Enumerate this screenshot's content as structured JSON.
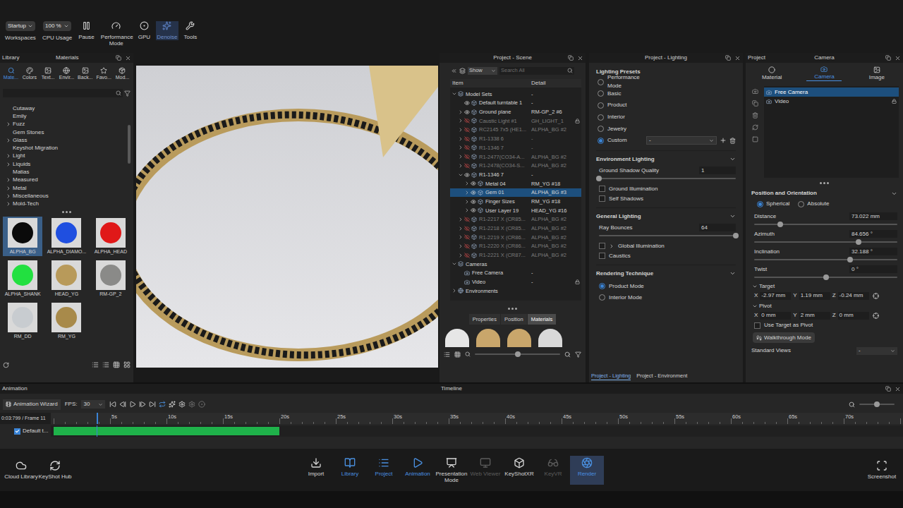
{
  "toolbar": {
    "items": [
      {
        "label": "Workspaces",
        "kind": "dropdown",
        "value": "Startup",
        "active": false
      },
      {
        "label": "CPU Usage",
        "kind": "dropdown",
        "value": "100 %",
        "active": false
      },
      {
        "label": "Pause",
        "kind": "button",
        "value": "",
        "active": false
      },
      {
        "label": "Performance Mode",
        "kind": "button",
        "value": "",
        "active": false
      },
      {
        "label": "GPU",
        "kind": "button",
        "value": "",
        "active": false
      },
      {
        "label": "Denoise",
        "kind": "button",
        "value": "",
        "active": true
      },
      {
        "label": "Tools",
        "kind": "button",
        "value": "",
        "active": false
      }
    ]
  },
  "library": {
    "title": "Library",
    "subtitle": "Materials",
    "tabs": [
      {
        "label": "Mate...",
        "selected": true
      },
      {
        "label": "Colors",
        "selected": false
      },
      {
        "label": "Text...",
        "selected": false
      },
      {
        "label": "Envir...",
        "selected": false
      },
      {
        "label": "Back...",
        "selected": false
      },
      {
        "label": "Favo...",
        "selected": false
      },
      {
        "label": "Mod...",
        "selected": false
      }
    ],
    "tree": [
      {
        "label": "Cutaway",
        "expandable": false
      },
      {
        "label": "Emily",
        "expandable": false
      },
      {
        "label": "Fuzz",
        "expandable": true
      },
      {
        "label": "Gem Stones",
        "expandable": false
      },
      {
        "label": "Glass",
        "expandable": true
      },
      {
        "label": "Keyshot Migration",
        "expandable": false
      },
      {
        "label": "Light",
        "expandable": true
      },
      {
        "label": "Liquids",
        "expandable": true
      },
      {
        "label": "Matias",
        "expandable": false
      },
      {
        "label": "Measured",
        "expandable": true
      },
      {
        "label": "Metal",
        "expandable": true
      },
      {
        "label": "Miscellaneous",
        "expandable": true
      },
      {
        "label": "Mold-Tech",
        "expandable": true
      }
    ],
    "thumbnails": [
      {
        "label": "ALPHA_BG",
        "selected": true,
        "color": "#0a0a0a"
      },
      {
        "label": "ALPHA_DIAMO...",
        "selected": false,
        "color": "#1f4fe0"
      },
      {
        "label": "ALPHA_HEAD",
        "selected": false,
        "color": "#e01818"
      },
      {
        "label": "ALPHA_SHANK",
        "selected": false,
        "color": "#22e040"
      },
      {
        "label": "HEAD_YG",
        "selected": false,
        "color": "#b89a5a"
      },
      {
        "label": "RM-GP_2",
        "selected": false,
        "color": "#8a8a88"
      },
      {
        "label": "RM_DD",
        "selected": false,
        "color": "#c8ccd0"
      },
      {
        "label": "RM_YG",
        "selected": false,
        "color": "#a88a4a"
      }
    ]
  },
  "scene": {
    "title": "Project - Scene",
    "filter": "Show",
    "search_placeholder": "Search All",
    "columns": [
      "Item",
      "Detail"
    ],
    "rows": [
      {
        "label": "Model Sets",
        "detail": "-",
        "kind": "category",
        "depth": 0,
        "toggle": "open",
        "visible": true,
        "selected": false,
        "locked": false
      },
      {
        "label": "Default turntable 1",
        "detail": "-",
        "kind": "model",
        "depth": 1,
        "toggle": "none",
        "visible": true,
        "selected": false,
        "locked": false
      },
      {
        "label": "Ground plane",
        "detail": "RM-GP_2 #6",
        "kind": "model",
        "depth": 1,
        "toggle": "closed",
        "visible": true,
        "selected": false,
        "locked": false
      },
      {
        "label": "Caustic Light #1",
        "detail": "GH_LIGHT_1",
        "kind": "model",
        "depth": 1,
        "toggle": "closed",
        "visible": false,
        "selected": false,
        "locked": true
      },
      {
        "label": "RC2145 7x5 (HE1...",
        "detail": "ALPHA_BG #2",
        "kind": "model",
        "depth": 1,
        "toggle": "closed",
        "visible": false,
        "selected": false,
        "locked": false
      },
      {
        "label": "R1-1338 6",
        "detail": "-",
        "kind": "model",
        "depth": 1,
        "toggle": "closed",
        "visible": false,
        "selected": false,
        "locked": false
      },
      {
        "label": "R1-1346 7",
        "detail": "-",
        "kind": "model",
        "depth": 1,
        "toggle": "closed",
        "visible": false,
        "selected": false,
        "locked": false
      },
      {
        "label": "R1-2477(CO34-A...",
        "detail": "ALPHA_BG #2",
        "kind": "model",
        "depth": 1,
        "toggle": "closed",
        "visible": false,
        "selected": false,
        "locked": false
      },
      {
        "label": "R1-2478(CO34-S...",
        "detail": "ALPHA_BG #2",
        "kind": "model",
        "depth": 1,
        "toggle": "closed",
        "visible": false,
        "selected": false,
        "locked": false
      },
      {
        "label": "R1-1346 7",
        "detail": "-",
        "kind": "model",
        "depth": 1,
        "toggle": "open",
        "visible": true,
        "selected": false,
        "locked": false
      },
      {
        "label": "Metal 04",
        "detail": "RM_YG #18",
        "kind": "model",
        "depth": 2,
        "toggle": "closed",
        "visible": true,
        "selected": false,
        "locked": false
      },
      {
        "label": "Gem 01",
        "detail": "ALPHA_BG #3",
        "kind": "model",
        "depth": 2,
        "toggle": "closed",
        "visible": true,
        "selected": true,
        "locked": false
      },
      {
        "label": "Finger Sizes",
        "detail": "RM_YG #18",
        "kind": "model",
        "depth": 2,
        "toggle": "closed",
        "visible": true,
        "selected": false,
        "locked": false
      },
      {
        "label": "User Layer 19",
        "detail": "HEAD_YG #16",
        "kind": "model",
        "depth": 2,
        "toggle": "closed",
        "visible": true,
        "selected": false,
        "locked": false
      },
      {
        "label": "R1-2217 X (CR85...",
        "detail": "ALPHA_BG #2",
        "kind": "model",
        "depth": 1,
        "toggle": "closed",
        "visible": false,
        "selected": false,
        "locked": false
      },
      {
        "label": "R1-2218 X (CR85...",
        "detail": "ALPHA_BG #2",
        "kind": "model",
        "depth": 1,
        "toggle": "closed",
        "visible": false,
        "selected": false,
        "locked": false
      },
      {
        "label": "R1-2219 X (CR86...",
        "detail": "ALPHA_BG #2",
        "kind": "model",
        "depth": 1,
        "toggle": "closed",
        "visible": false,
        "selected": false,
        "locked": false
      },
      {
        "label": "R1-2220 X (CR86...",
        "detail": "ALPHA_BG #2",
        "kind": "model",
        "depth": 1,
        "toggle": "closed",
        "visible": false,
        "selected": false,
        "locked": false
      },
      {
        "label": "R1-2221 X (CR87...",
        "detail": "ALPHA_BG #2",
        "kind": "model",
        "depth": 1,
        "toggle": "closed",
        "visible": false,
        "selected": false,
        "locked": false
      },
      {
        "label": "Cameras",
        "detail": "",
        "kind": "category",
        "depth": 0,
        "toggle": "open",
        "visible": true,
        "selected": false,
        "locked": false
      },
      {
        "label": "Free Camera",
        "detail": "-",
        "kind": "camera",
        "depth": 1,
        "toggle": "none",
        "visible": true,
        "selected": false,
        "locked": false
      },
      {
        "label": "Video",
        "detail": "-",
        "kind": "camera",
        "depth": 1,
        "toggle": "none",
        "visible": true,
        "selected": false,
        "locked": true
      },
      {
        "label": "Environments",
        "detail": "",
        "kind": "environment",
        "depth": 0,
        "toggle": "closed",
        "visible": true,
        "selected": false,
        "locked": false
      }
    ],
    "tabs": [
      {
        "label": "Properties",
        "selected": false
      },
      {
        "label": "Position",
        "selected": false
      },
      {
        "label": "Materials",
        "selected": true
      }
    ],
    "swatches": [
      {
        "color": "#e6e6e6"
      },
      {
        "color": "#c9a66b"
      },
      {
        "color": "#c9a66b"
      },
      {
        "color": "#d9d9d9"
      }
    ]
  },
  "lighting": {
    "title": "Project - Lighting",
    "presets_title": "Lighting Presets",
    "presets": [
      {
        "label": "Performance Mode",
        "selected": false
      },
      {
        "label": "Basic",
        "selected": false
      },
      {
        "label": "Product",
        "selected": false
      },
      {
        "label": "Interior",
        "selected": false
      },
      {
        "label": "Jewelry",
        "selected": false
      },
      {
        "label": "Custom",
        "selected": true
      }
    ],
    "custom_value": "-",
    "sections": [
      {
        "title": "Environment Lighting",
        "expanded": true,
        "rows": [
          {
            "kind": "slider",
            "label": "Ground Shadow Quality",
            "value": "1",
            "level": 0,
            "checked": false,
            "selected": false,
            "expandable": false
          },
          {
            "kind": "checkbox",
            "label": "Ground Illumination",
            "value": "",
            "level": 0,
            "checked": false,
            "selected": false,
            "expandable": false
          },
          {
            "kind": "checkbox",
            "label": "Self Shadows",
            "value": "",
            "level": 0,
            "checked": false,
            "selected": false,
            "expandable": false
          }
        ]
      },
      {
        "title": "General Lighting",
        "expanded": true,
        "rows": [
          {
            "kind": "slider",
            "label": "Ray Bounces",
            "value": "64",
            "level": 1,
            "checked": false,
            "selected": false,
            "expandable": false
          },
          {
            "kind": "checkbox",
            "label": "Global Illumination",
            "value": "",
            "level": 0,
            "checked": false,
            "selected": false,
            "expandable": true
          },
          {
            "kind": "checkbox",
            "label": "Caustics",
            "value": "",
            "level": 0,
            "checked": false,
            "selected": false,
            "expandable": false
          }
        ]
      },
      {
        "title": "Rendering Technique",
        "expanded": true,
        "rows": [
          {
            "kind": "radio",
            "label": "Product Mode",
            "value": "",
            "level": 0,
            "checked": false,
            "selected": true,
            "expandable": false
          },
          {
            "kind": "radio",
            "label": "Interior Mode",
            "value": "",
            "level": 0,
            "checked": false,
            "selected": false,
            "expandable": false
          }
        ]
      }
    ],
    "tabs": [
      {
        "label": "Project - Lighting",
        "selected": true
      },
      {
        "label": "Project - Environment",
        "selected": false
      }
    ]
  },
  "camera": {
    "project_label": "Project",
    "title": "Camera",
    "tabs": [
      {
        "label": "Material",
        "selected": false
      },
      {
        "label": "Camera",
        "selected": true
      },
      {
        "label": "Image",
        "selected": false
      }
    ],
    "cameras": [
      {
        "label": "Free Camera",
        "selected": true,
        "locked": false
      },
      {
        "label": "Video",
        "selected": false,
        "locked": true
      }
    ],
    "section": "Position and Orientation",
    "modes": [
      {
        "label": "Spherical",
        "selected": true
      },
      {
        "label": "Absolute",
        "selected": false
      }
    ],
    "sliders": [
      {
        "label": "Distance",
        "value": "73.022 mm",
        "level": 0.18
      },
      {
        "label": "Azimuth",
        "value": "84.656 °",
        "level": 0.73
      },
      {
        "label": "Inclination",
        "value": "32.188 °",
        "level": 0.67
      },
      {
        "label": "Twist",
        "value": "0 °",
        "level": 0.5
      }
    ],
    "groups": [
      {
        "label": "Target",
        "expanded": true,
        "fields": [
          {
            "axis": "X",
            "value": "-2.97 mm"
          },
          {
            "axis": "Y",
            "value": "1.19 mm"
          },
          {
            "axis": "Z",
            "value": "-0.24 mm"
          }
        ]
      },
      {
        "label": "Pivot",
        "expanded": true,
        "fields": [
          {
            "axis": "X",
            "value": "0 mm"
          },
          {
            "axis": "Y",
            "value": "2 mm"
          },
          {
            "axis": "Z",
            "value": "0 mm"
          }
        ]
      }
    ],
    "use_target": {
      "label": "Use Target as Pivot",
      "checked": false
    },
    "walkthrough": "Walkthrough Mode",
    "standard_views": {
      "label": "Standard Views",
      "value": "-"
    }
  },
  "timeline": {
    "panel": "Animation",
    "title": "Timeline",
    "wizard": "Animation Wizard",
    "fps_label": "FPS:",
    "fps": "30",
    "time": "0:03:799 / Frame 11",
    "ticks": [
      {
        "label": "5s",
        "sec": 5
      },
      {
        "label": "10s",
        "sec": 10
      },
      {
        "label": "15s",
        "sec": 15
      },
      {
        "label": "20s",
        "sec": 20
      },
      {
        "label": "25s",
        "sec": 25
      },
      {
        "label": "30s",
        "sec": 30
      },
      {
        "label": "35s",
        "sec": 35
      },
      {
        "label": "40s",
        "sec": 40
      },
      {
        "label": "45s",
        "sec": 45
      },
      {
        "label": "50s",
        "sec": 50
      },
      {
        "label": "55s",
        "sec": 55
      },
      {
        "label": "60s",
        "sec": 60
      },
      {
        "label": "65s",
        "sec": 65
      },
      {
        "label": "70s",
        "sec": 70
      }
    ],
    "playhead": 3.8,
    "tracks": [
      {
        "label": "Default t...",
        "checked": true,
        "start": 0,
        "end": 20,
        "color": "#1fb24a"
      }
    ]
  },
  "dock": {
    "left": [
      {
        "label": "Cloud Library",
        "active": false,
        "disabled": false,
        "boxed": false
      },
      {
        "label": "KeyShot Hub",
        "active": false,
        "disabled": false,
        "boxed": false
      }
    ],
    "center": [
      {
        "label": "Import",
        "active": false,
        "disabled": false,
        "boxed": false
      },
      {
        "label": "Library",
        "active": true,
        "disabled": false,
        "boxed": false
      },
      {
        "label": "Project",
        "active": true,
        "disabled": false,
        "boxed": false
      },
      {
        "label": "Animation",
        "active": true,
        "disabled": false,
        "boxed": false
      },
      {
        "label": "Presentation Mode",
        "active": false,
        "disabled": false,
        "boxed": false
      },
      {
        "label": "Web Viewer",
        "active": false,
        "disabled": true,
        "boxed": false
      },
      {
        "label": "KeyShotXR",
        "active": false,
        "disabled": false,
        "boxed": false
      },
      {
        "label": "KeyVR",
        "active": false,
        "disabled": true,
        "boxed": false
      },
      {
        "label": "Render",
        "active": true,
        "disabled": false,
        "boxed": true
      }
    ],
    "right": [
      {
        "label": "Screenshot",
        "active": false,
        "disabled": false,
        "boxed": false
      }
    ]
  }
}
